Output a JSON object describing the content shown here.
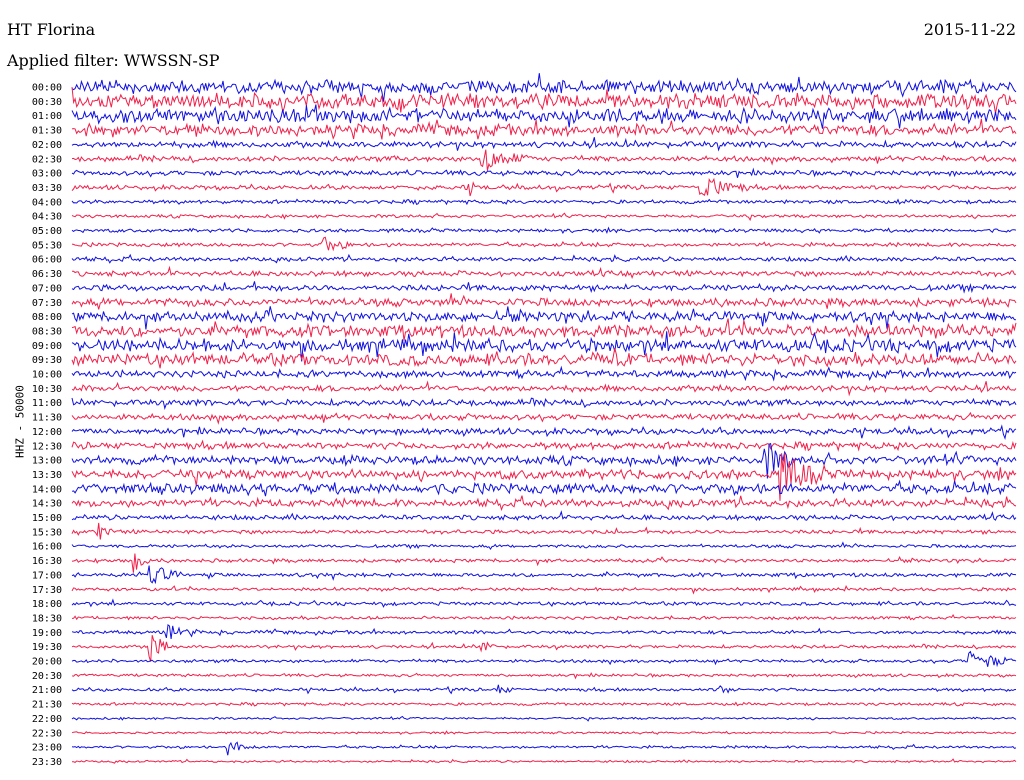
{
  "header": {
    "station": "HT Florina",
    "date": "2015-11-22",
    "filter": "Applied filter: WWSSN-SP",
    "channel": "HHZ - 50000"
  },
  "colors": {
    "trace_a": "#1010e0",
    "trace_b": "#f0204a"
  },
  "chart_data": {
    "type": "line",
    "title": "HT Florina",
    "subtitle": "Applied filter: WWSSN-SP",
    "date": "2015-11-22",
    "ylabel": "HHZ - 50000",
    "row_labels": [
      "00:00",
      "00:30",
      "01:00",
      "01:30",
      "02:00",
      "02:30",
      "03:00",
      "03:30",
      "04:00",
      "04:30",
      "05:00",
      "05:30",
      "06:00",
      "06:30",
      "07:00",
      "07:30",
      "08:00",
      "08:30",
      "09:00",
      "09:30",
      "10:00",
      "10:30",
      "11:00",
      "11:30",
      "12:00",
      "12:30",
      "13:00",
      "13:30",
      "14:00",
      "14:30",
      "15:00",
      "15:30",
      "16:00",
      "16:30",
      "17:00",
      "17:30",
      "18:00",
      "18:30",
      "19:00",
      "19:30",
      "20:00",
      "20:30",
      "21:00",
      "21:30",
      "22:00",
      "22:30",
      "23:00",
      "23:30"
    ],
    "row_noise": [
      0.75,
      0.85,
      0.8,
      0.65,
      0.35,
      0.3,
      0.28,
      0.25,
      0.22,
      0.18,
      0.2,
      0.22,
      0.25,
      0.3,
      0.35,
      0.45,
      0.6,
      0.7,
      0.75,
      0.7,
      0.4,
      0.35,
      0.35,
      0.35,
      0.35,
      0.4,
      0.5,
      0.55,
      0.6,
      0.45,
      0.28,
      0.22,
      0.18,
      0.2,
      0.22,
      0.18,
      0.2,
      0.18,
      0.2,
      0.18,
      0.18,
      0.16,
      0.18,
      0.16,
      0.12,
      0.12,
      0.15,
      0.12
    ],
    "events": [
      {
        "row": 5,
        "minute": 13,
        "amp": 1.5,
        "dur": 1.5
      },
      {
        "row": 7,
        "minute": 20,
        "amp": 1.5,
        "dur": 1.5
      },
      {
        "row": 7,
        "minute": 12.5,
        "amp": 0.8,
        "dur": 0.5
      },
      {
        "row": 11,
        "minute": 8,
        "amp": 0.8,
        "dur": 1.0
      },
      {
        "row": 26,
        "minute": 22,
        "amp": 2.2,
        "dur": 1.0
      },
      {
        "row": 27,
        "minute": 22.5,
        "amp": 2.5,
        "dur": 1.5
      },
      {
        "row": 31,
        "minute": 0.8,
        "amp": 1.0,
        "dur": 0.6
      },
      {
        "row": 33,
        "minute": 2.0,
        "amp": 1.2,
        "dur": 0.5
      },
      {
        "row": 34,
        "minute": 2.5,
        "amp": 1.3,
        "dur": 1.0
      },
      {
        "row": 38,
        "minute": 3.0,
        "amp": 0.9,
        "dur": 1.0
      },
      {
        "row": 39,
        "minute": 2.5,
        "amp": 2.5,
        "dur": 0.6
      },
      {
        "row": 39,
        "minute": 13,
        "amp": 0.8,
        "dur": 0.5
      },
      {
        "row": 40,
        "minute": 28.5,
        "amp": 1.4,
        "dur": 1.5
      },
      {
        "row": 42,
        "minute": 13.5,
        "amp": 0.6,
        "dur": 0.6
      },
      {
        "row": 42,
        "minute": 20.5,
        "amp": 0.6,
        "dur": 0.6
      },
      {
        "row": 46,
        "minute": 5,
        "amp": 0.7,
        "dur": 1.0
      }
    ]
  }
}
